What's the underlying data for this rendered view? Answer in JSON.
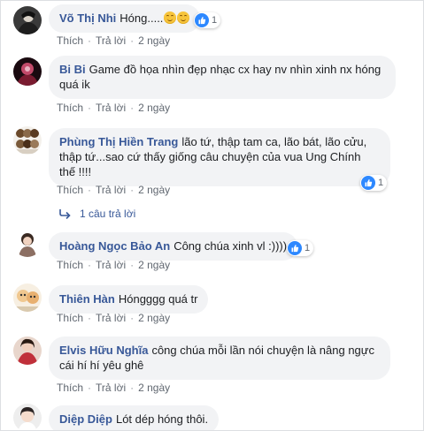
{
  "actions": {
    "like": "Thích",
    "reply": "Trả lời",
    "dot": "·"
  },
  "colors": {
    "author": "#385898",
    "bubble": "#f2f3f5",
    "meta": "#606770",
    "like": "#2d88ff"
  },
  "comments": [
    {
      "author": "Võ Thị Nhi",
      "text": "Hóng.....",
      "emoji": [
        "smiling-face",
        "smiling-face"
      ],
      "time": "2 ngày",
      "reactions": "1"
    },
    {
      "author": "Bi Bi",
      "text": "Game đồ họa nhìn đẹp nhạc cx hay nv nhìn xinh nx hóng quá ik",
      "time": "2 ngày"
    },
    {
      "author": "Phùng Thị Hiền Trang",
      "text": "lão tứ, thập tam ca, lão bát, lão cửu, thập tứ...sao cứ thấy giống câu chuyện của vua Ung Chính thế !!!!",
      "time": "2 ngày",
      "reactions": "1",
      "replies": "1 câu trả lời"
    },
    {
      "author": "Hoàng Ngọc Bảo An",
      "text": "Công chúa xinh vl :))))",
      "time": "2 ngày",
      "reactions": "1"
    },
    {
      "author": "Thiên Hàn",
      "text": "Hóngggg quá tr",
      "time": "2 ngày"
    },
    {
      "author": "Elvis Hữu Nghĩa",
      "text": "công chúa mỗi lần nói chuyện là nâng ngực cái hí hí yêu ghê",
      "time": "2 ngày"
    },
    {
      "author": "Diệp Diệp",
      "text": "Lót dép hóng thôi."
    }
  ]
}
